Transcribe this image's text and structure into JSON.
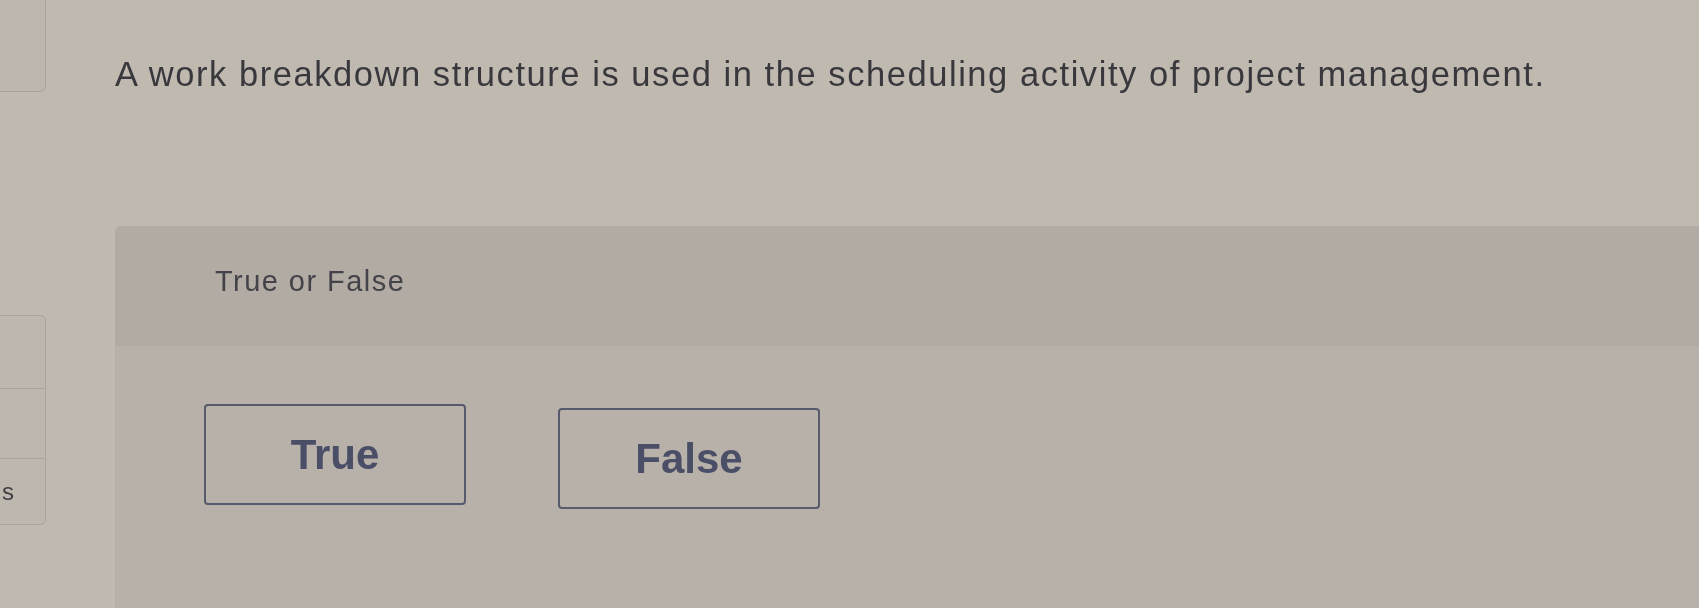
{
  "sidebar": {
    "label": "s"
  },
  "question": {
    "text": "A work breakdown structure is used in the scheduling activity of project management."
  },
  "answer_panel": {
    "prompt": "True or False",
    "options": [
      {
        "label": "True",
        "selected": false
      },
      {
        "label": "False",
        "selected": false
      }
    ]
  }
}
